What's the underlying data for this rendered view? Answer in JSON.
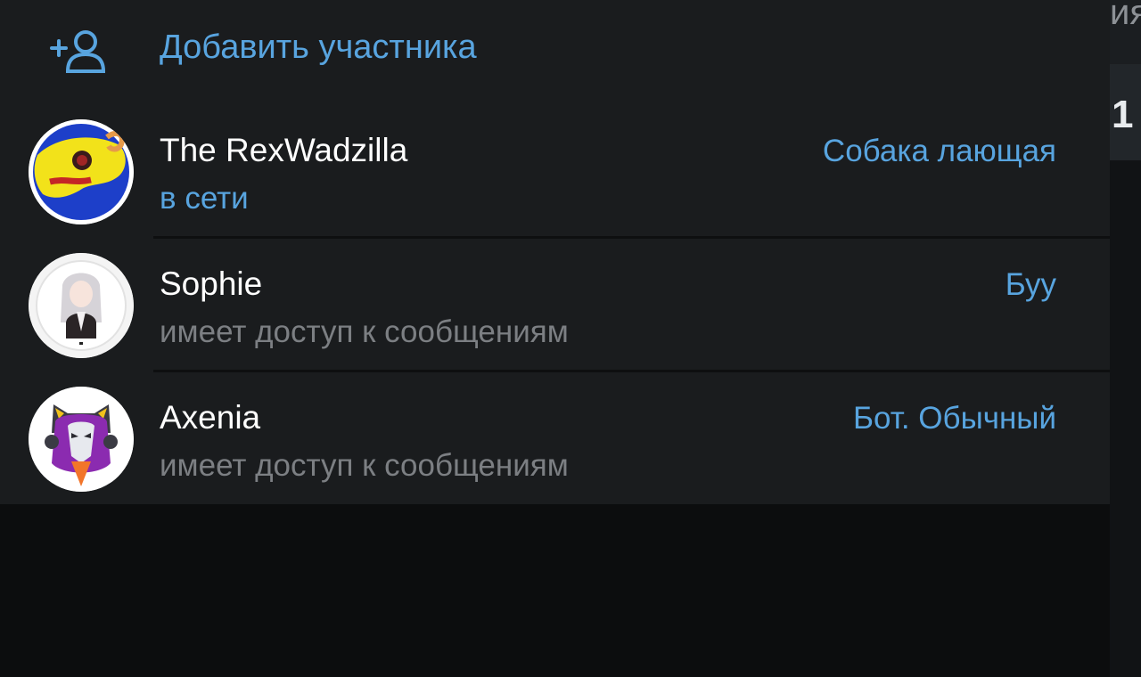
{
  "panel": {
    "add_member_label": "Добавить участника",
    "add_member_icon": "add-user-icon"
  },
  "members": [
    {
      "name": "The RexWadzilla",
      "status": "в сети",
      "role": "Собака лающая",
      "avatar": "dragon-avatar"
    },
    {
      "name": "Sophie",
      "status": "имеет доступ к сообщениям",
      "role": "Буу",
      "avatar": "anime-girl-avatar"
    },
    {
      "name": "Axenia",
      "status": "имеет доступ к сообщениям",
      "role": "Бот. Обычный",
      "avatar": "masked-character-avatar"
    }
  ],
  "background": {
    "top_fragment": "ия",
    "mid_fragment": "1"
  },
  "colors": {
    "accent": "#58a4df",
    "panel": "#1a1c1e",
    "muted_text": "#7c7f83"
  }
}
